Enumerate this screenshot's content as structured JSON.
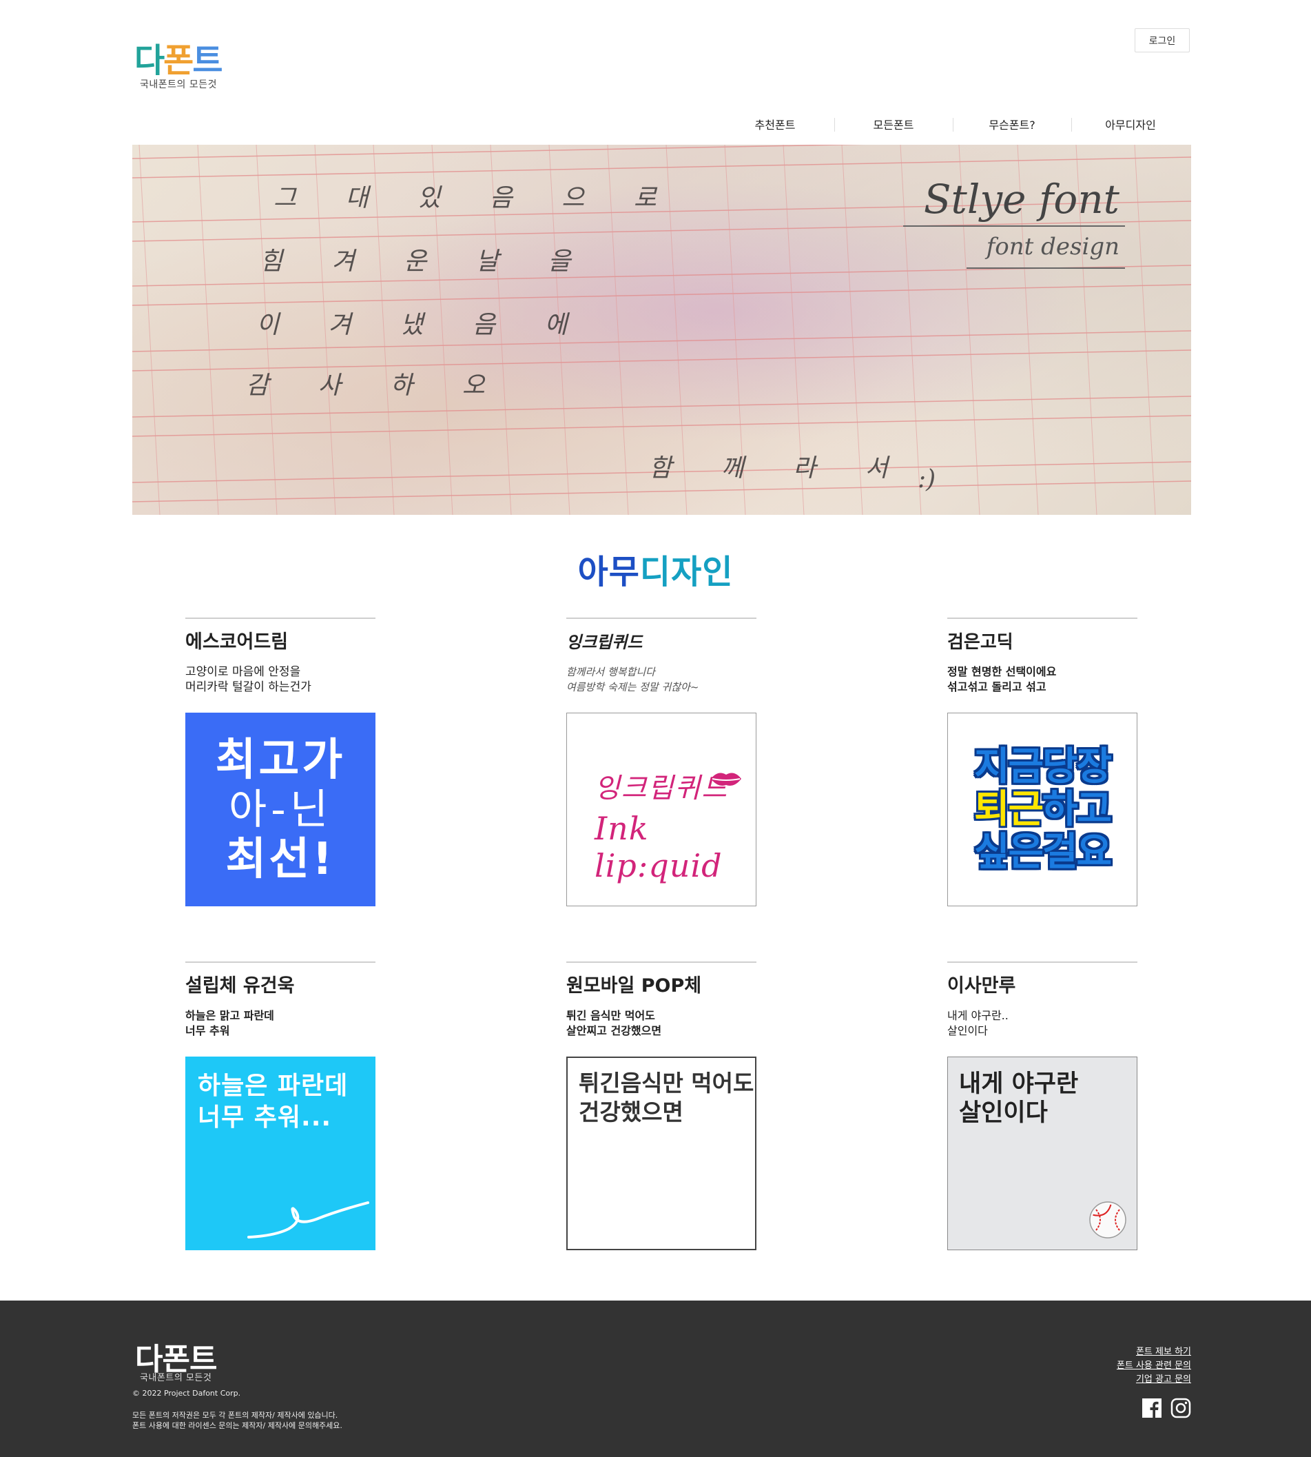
{
  "header": {
    "logo": {
      "chars": [
        "다",
        "폰",
        "트"
      ],
      "colors": [
        "#22a39a",
        "#f0a030",
        "#4a8ee0"
      ],
      "subtitle": "국내폰트의 모든것"
    },
    "login_label": "로그인",
    "nav": [
      "추천폰트",
      "모든폰트",
      "무슨폰트?",
      "아무디자인"
    ]
  },
  "hero": {
    "handwriting": [
      "그 대 있 음 으 로",
      "힘 겨 운 날 을",
      "이 겨 냈 음 에",
      "감 사 하 오",
      "함 께 라 서"
    ],
    "smiley": ":)",
    "title": "Stlye font",
    "subtitle": "font design"
  },
  "section": {
    "title_part1": "아무",
    "title_part2": "디자인"
  },
  "cards": [
    {
      "name": "에스코어드림",
      "desc1": "고양이로 마음에 안정을",
      "desc2": "머리카락 털갈이 하는건가",
      "img_lines": [
        "최고가",
        "아-닌",
        "최선!"
      ]
    },
    {
      "name": "잉크립퀴드",
      "desc1": "함께라서 행복합니다",
      "desc2": "여름방학 숙제는 정말 귀찮아~",
      "img_lines": [
        "잉크립퀴드",
        "Ink lip:quid"
      ]
    },
    {
      "name": "검은고딕",
      "desc1": "정말 현명한 선택이에요",
      "desc2": "섞고섞고 돌리고 섞고",
      "img_lines": [
        "지금당장",
        "퇴근",
        "하고",
        "싶은걸요"
      ]
    },
    {
      "name": "설립체 유건욱",
      "desc1": "하늘은 맑고 파란데",
      "desc2": "너무 추워",
      "img_lines": [
        "하늘은 파란데",
        "너무 추워..."
      ]
    },
    {
      "name": "원모바일 POP체",
      "desc1": "튀긴 음식만 먹어도",
      "desc2": "살안찌고 건강했으면",
      "img_lines": [
        "튀긴음식만 먹어도",
        "건강했으면"
      ]
    },
    {
      "name": "이사만루",
      "desc1": "내게 야구란..",
      "desc2": "살인이다",
      "img_lines": [
        "내게 야구란",
        "살인이다"
      ]
    }
  ],
  "footer": {
    "logo": "다폰트",
    "logo_sub": "국내폰트의 모든것",
    "copyright": "© 2022 Project Dafont Corp.",
    "note1": "모든 폰트의 저작권은 모두 각 폰트의 제작자/ 제작사에 있습니다.",
    "note2": "폰트 사용에 대한 라이센스 문의는 제작자/ 제작사에 문의해주세요.",
    "links": [
      "폰트 제보 하기",
      "폰트 사용 관련 문의",
      "기업 광고 문의"
    ],
    "social_icons": [
      "facebook-icon",
      "instagram-icon"
    ]
  }
}
